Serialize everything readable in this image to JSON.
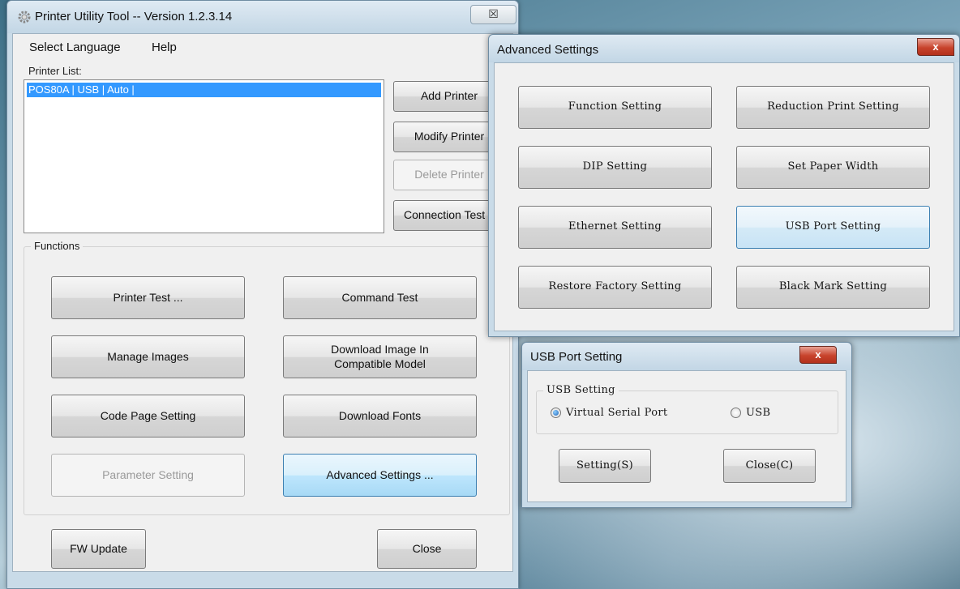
{
  "main": {
    "title": "Printer Utility Tool -- Version 1.2.3.14",
    "close_glyph": "☒",
    "menu": [
      "Select Language",
      "Help"
    ],
    "printer_list_label": "Printer List:",
    "printers": [
      "POS80A | USB | Auto |"
    ],
    "side_buttons": {
      "add": "Add Printer",
      "modify": "Modify Printer",
      "delete": "Delete Printer",
      "connection": "Connection Test"
    },
    "functions_label": "Functions",
    "functions": {
      "printer_test": "Printer Test ...",
      "command_test": "Command Test",
      "manage_images": "Manage Images",
      "download_image": "Download Image In\nCompatible Model",
      "code_page": "Code Page Setting",
      "download_fonts": "Download Fonts",
      "parameter": "Parameter Setting",
      "advanced": "Advanced Settings ..."
    },
    "fw_update": "FW Update",
    "close": "Close"
  },
  "advanced": {
    "title": "Advanced Settings",
    "close_glyph": "x",
    "buttons": {
      "function": "Function Setting",
      "reduction": "Reduction Print Setting",
      "dip": "DIP Setting",
      "paper_width": "Set Paper Width",
      "ethernet": "Ethernet Setting",
      "usb_port": "USB Port Setting",
      "restore": "Restore Factory Setting",
      "black_mark": "Black Mark Setting"
    }
  },
  "usb": {
    "title": "USB Port Setting",
    "close_glyph": "x",
    "group_label": "USB Setting",
    "option_virtual": "Virtual Serial Port",
    "option_usb": "USB",
    "selected": "Virtual Serial Port",
    "setting_button": "Setting(S)",
    "close_button": "Close(C)"
  },
  "colors": {
    "selection": "#3399ff",
    "close_red": "#c7432c",
    "titlebar": "#c9dbe8"
  }
}
